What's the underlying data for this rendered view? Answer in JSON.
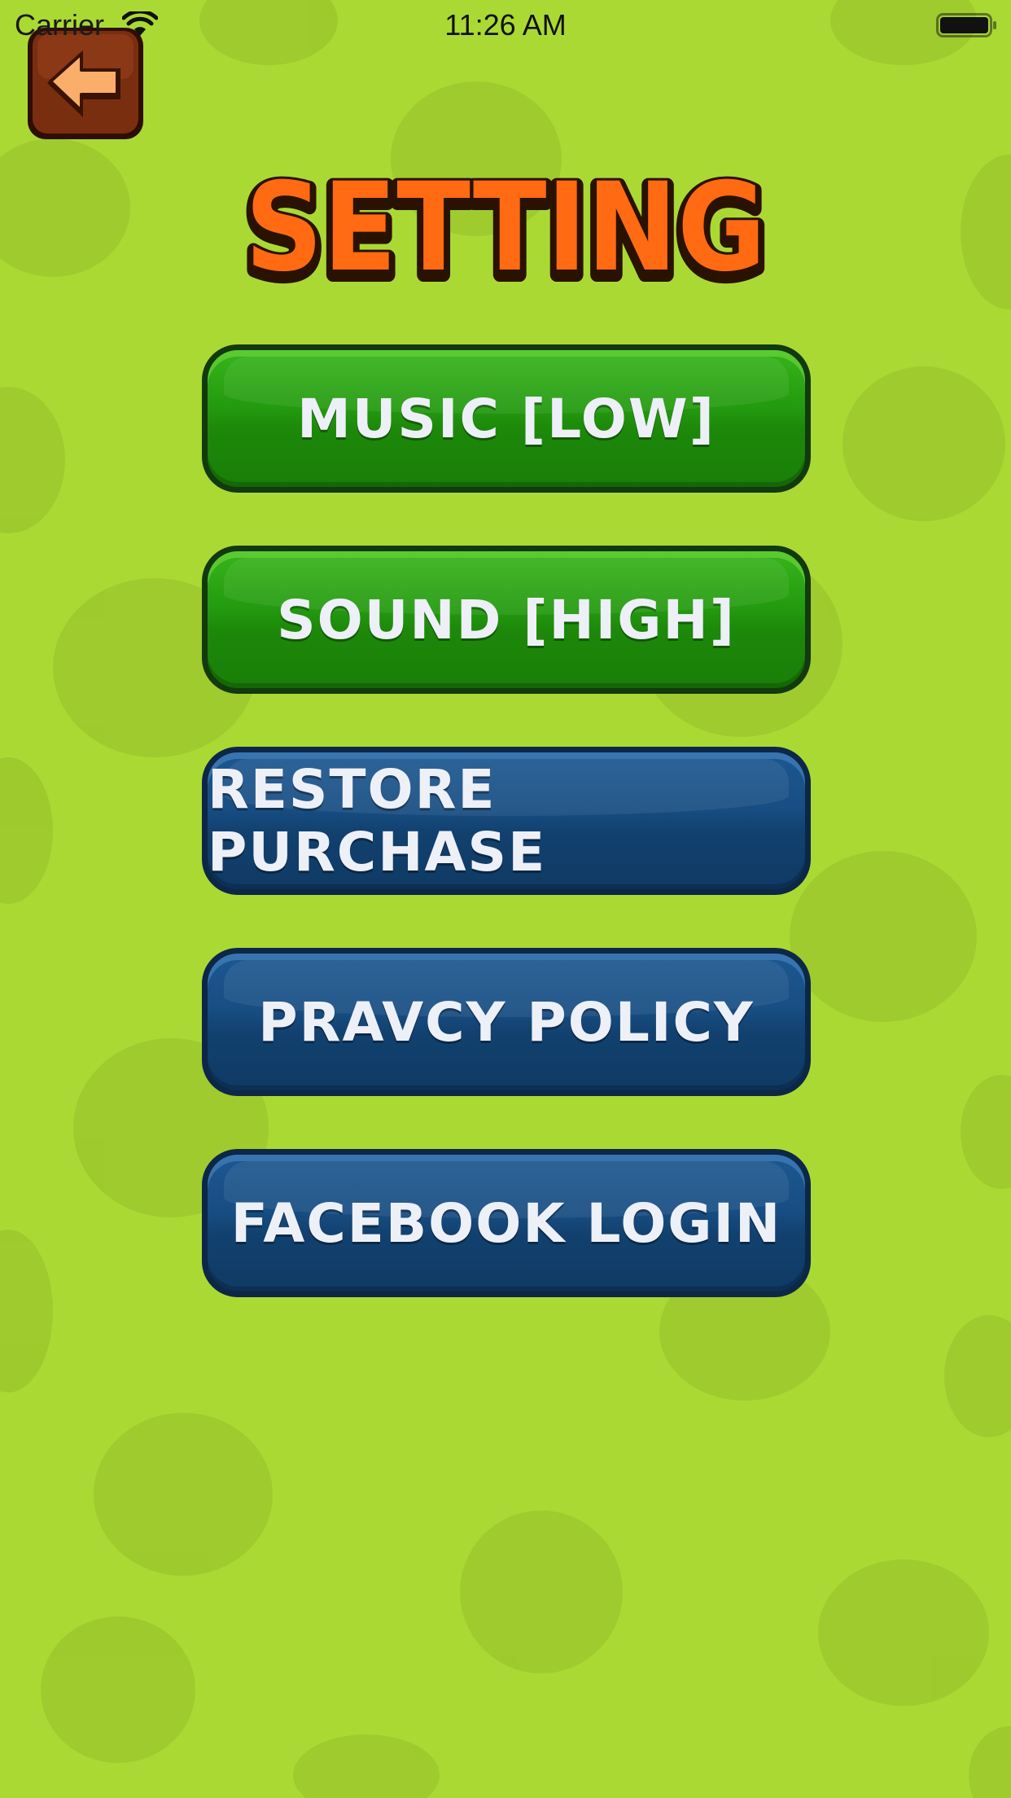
{
  "status_bar": {
    "carrier": "Carrier",
    "time": "11:26 AM",
    "wifi_icon": "wifi-icon",
    "battery_icon": "battery-icon"
  },
  "back_button": {
    "icon": "back-arrow-icon"
  },
  "title": "SETTING",
  "menu": {
    "buttons": [
      {
        "label": "MUSIC [LOW]",
        "color": "#239a0f"
      },
      {
        "label": "SOUND [HIGH]",
        "color": "#239a0f"
      },
      {
        "label": "RESTORE PURCHASE",
        "color": "#174d82"
      },
      {
        "label": "PRAVCY POLICY",
        "color": "#174d82"
      },
      {
        "label": "FACEBOOK LOGIN",
        "color": "#174d82"
      }
    ]
  },
  "colors": {
    "background": "#abd934",
    "title_fill": "#ff6a13",
    "back_button": "#7a2e10"
  }
}
